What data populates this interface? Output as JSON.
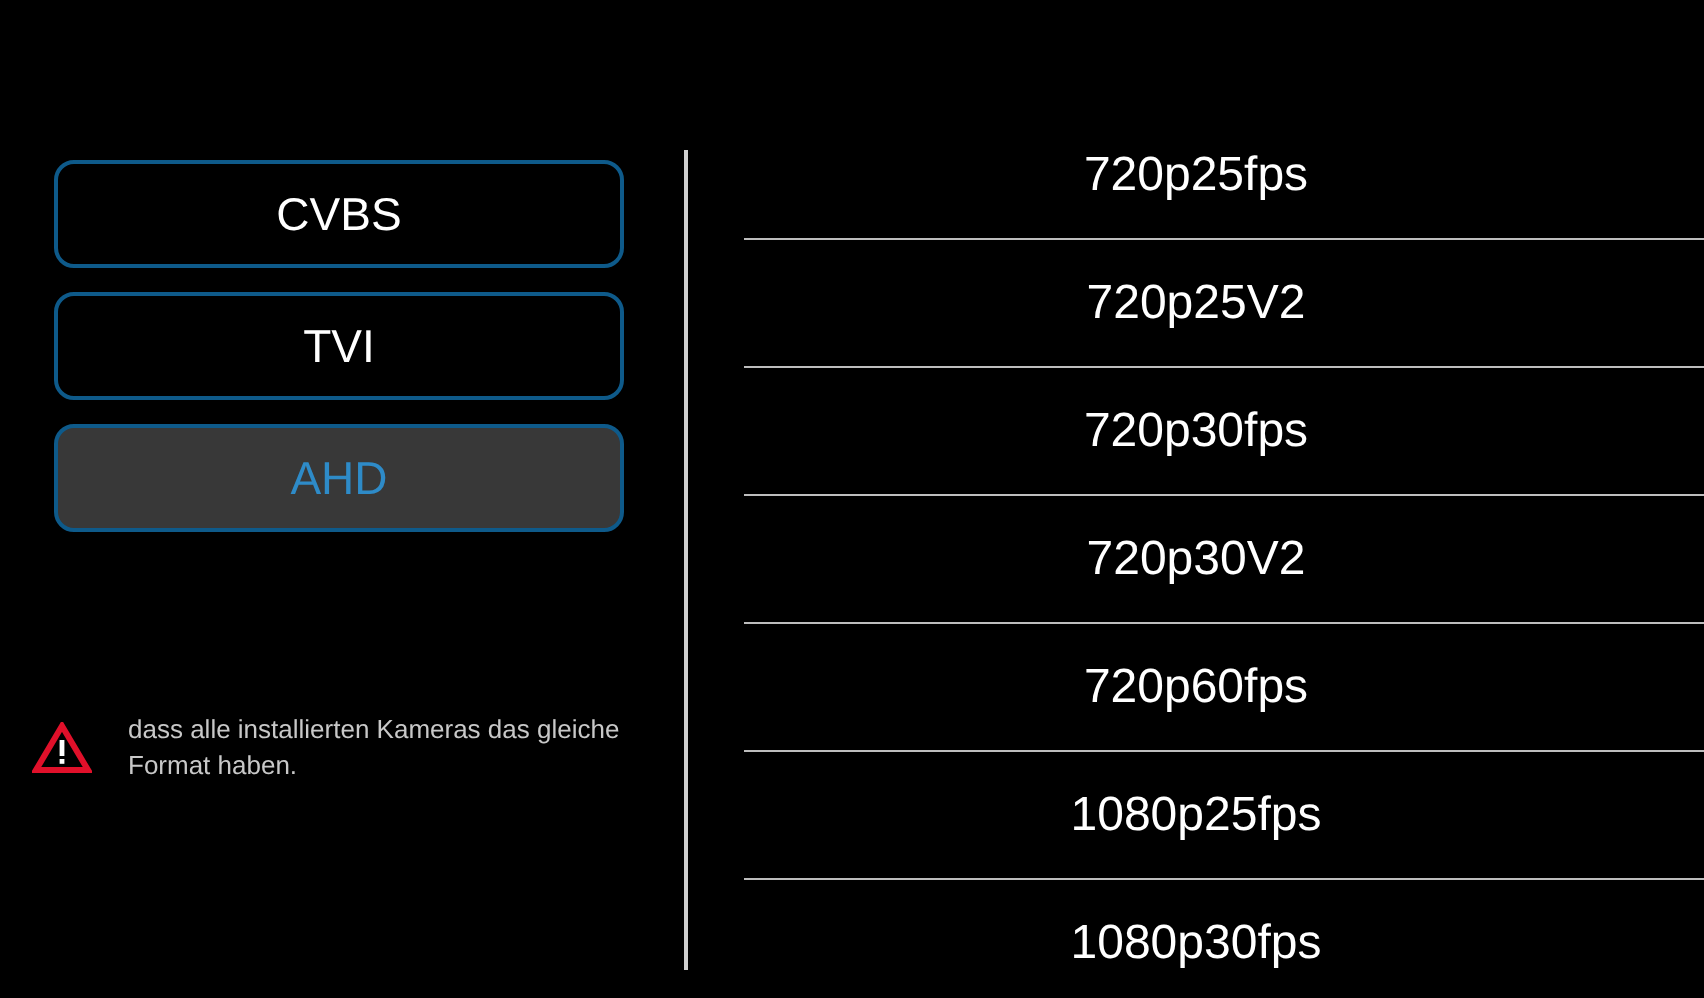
{
  "signal_types": [
    {
      "label": "CVBS",
      "selected": false
    },
    {
      "label": "TVI",
      "selected": false
    },
    {
      "label": "AHD",
      "selected": true
    }
  ],
  "warning": {
    "text": "dass alle installierten Kameras das gleiche Format haben."
  },
  "formats": [
    {
      "label": "720p25fps"
    },
    {
      "label": "720p25V2"
    },
    {
      "label": "720p30fps"
    },
    {
      "label": "720p30V2"
    },
    {
      "label": "720p60fps"
    },
    {
      "label": "1080p25fps"
    },
    {
      "label": "1080p30fps"
    }
  ]
}
